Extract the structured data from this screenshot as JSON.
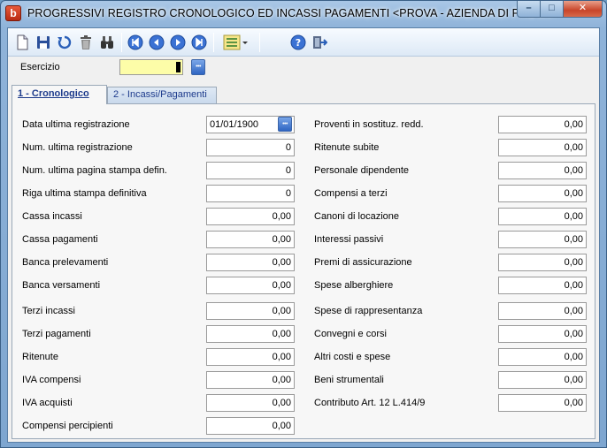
{
  "window": {
    "title": "PROGRESSIVI REGISTRO CRONOLOGICO ED INCASSI PAGAMENTI <PROVA - AZIENDA DI PROVA>",
    "app_icon_letter": "b",
    "minimize": "–",
    "maximize": "□",
    "close": "✕"
  },
  "toolbar": {
    "items": [
      "new-document-icon",
      "save-icon",
      "undo-icon",
      "delete-icon",
      "search-icon",
      "first-record-icon",
      "previous-record-icon",
      "next-record-icon",
      "last-record-icon",
      "list-options-icon",
      "help-icon",
      "exit-icon"
    ]
  },
  "esercizio": {
    "label": "Esercizio",
    "value": ""
  },
  "tabs": [
    {
      "num": "1",
      "label": "Cronologico",
      "full": "1 - Cronologico"
    },
    {
      "num": "2",
      "label": "Incassi/Pagamenti",
      "full": "2 - Incassi/Pagamenti"
    }
  ],
  "left_fields": [
    {
      "label": "Data ultima registrazione",
      "value": "01/01/1900"
    },
    {
      "label": "Num. ultima registrazione",
      "value": "0"
    },
    {
      "label": "Num. ultima pagina stampa defin.",
      "value": "0"
    },
    {
      "label": "Riga ultima stampa definitiva",
      "value": "0"
    },
    {
      "label": "Cassa incassi",
      "value": "0,00"
    },
    {
      "label": "Cassa pagamenti",
      "value": "0,00"
    },
    {
      "label": "Banca prelevamenti",
      "value": "0,00"
    },
    {
      "label": "Banca versamenti",
      "value": "0,00"
    },
    {
      "label": "Terzi incassi",
      "value": "0,00"
    },
    {
      "label": "Terzi pagamenti",
      "value": "0,00"
    },
    {
      "label": "Ritenute",
      "value": "0,00"
    },
    {
      "label": "IVA compensi",
      "value": "0,00"
    },
    {
      "label": "IVA acquisti",
      "value": "0,00"
    },
    {
      "label": "Compensi percipienti",
      "value": "0,00"
    }
  ],
  "right_fields": [
    {
      "label": "Proventi in sostituz. redd.",
      "value": "0,00"
    },
    {
      "label": "Ritenute subite",
      "value": "0,00"
    },
    {
      "label": "Personale dipendente",
      "value": "0,00"
    },
    {
      "label": "Compensi a terzi",
      "value": "0,00"
    },
    {
      "label": "Canoni di locazione",
      "value": "0,00"
    },
    {
      "label": "Interessi passivi",
      "value": "0,00"
    },
    {
      "label": "Premi di assicurazione",
      "value": "0,00"
    },
    {
      "label": "Spese alberghiere",
      "value": "0,00"
    },
    {
      "label": "Spese di rappresentanza",
      "value": "0,00"
    },
    {
      "label": "Convegni e corsi",
      "value": "0,00"
    },
    {
      "label": "Altri costi e spese",
      "value": "0,00"
    },
    {
      "label": "Beni strumentali",
      "value": "0,00"
    },
    {
      "label": "Contributo Art. 12 L.414/9",
      "value": "0,00"
    }
  ],
  "colors": {
    "accent": "#2f65c2",
    "highlight_input": "#fdfda8",
    "tab_text": "#1d3b8c"
  }
}
